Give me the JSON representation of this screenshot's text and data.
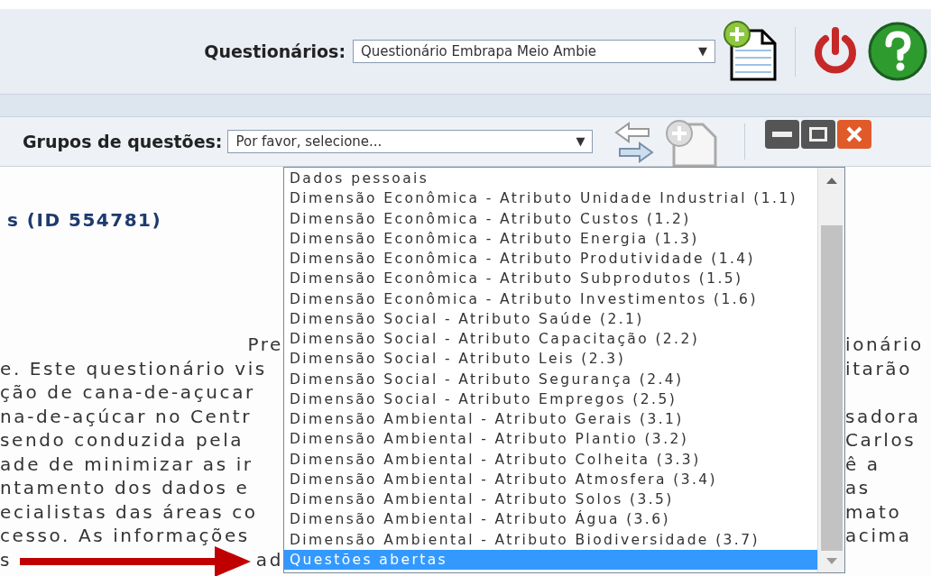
{
  "questionnaire_bar": {
    "label": "Questionários:",
    "value": "Questionário Embrapa Meio Ambie",
    "arrow": "▼"
  },
  "group_bar": {
    "label": "Grupos de questões:",
    "value": "Por favor, selecione...",
    "arrow": "▼"
  },
  "group_options": [
    {
      "label": "Dados pessoais",
      "selected": false
    },
    {
      "label": "Dimensão Econômica - Atributo Unidade Industrial (1.1)",
      "selected": false
    },
    {
      "label": "Dimensão Econômica - Atributo Custos (1.2)",
      "selected": false
    },
    {
      "label": "Dimensão Econômica - Atributo Energia (1.3)",
      "selected": false
    },
    {
      "label": "Dimensão Econômica - Atributo Produtividade (1.4)",
      "selected": false
    },
    {
      "label": "Dimensão Econômica - Atributo Subprodutos (1.5)",
      "selected": false
    },
    {
      "label": "Dimensão Econômica - Atributo Investimentos (1.6)",
      "selected": false
    },
    {
      "label": "Dimensão Social - Atributo Saúde (2.1)",
      "selected": false
    },
    {
      "label": "Dimensão Social - Atributo Capacitação (2.2)",
      "selected": false
    },
    {
      "label": "Dimensão Social - Atributo Leis (2.3)",
      "selected": false
    },
    {
      "label": "Dimensão Social - Atributo Segurança (2.4)",
      "selected": false
    },
    {
      "label": "Dimensão Social - Atributo Empregos (2.5)",
      "selected": false
    },
    {
      "label": "Dimensão Ambiental - Atributo Gerais (3.1)",
      "selected": false
    },
    {
      "label": "Dimensão Ambiental - Atributo Plantio (3.2)",
      "selected": false
    },
    {
      "label": "Dimensão Ambiental - Atributo Colheita (3.3)",
      "selected": false
    },
    {
      "label": "Dimensão Ambiental - Atributo Atmosfera (3.4)",
      "selected": false
    },
    {
      "label": "Dimensão Ambiental - Atributo Solos (3.5)",
      "selected": false
    },
    {
      "label": "Dimensão Ambiental - Atributo Água (3.6)",
      "selected": false
    },
    {
      "label": "Dimensão Ambiental - Atributo Biodiversidade (3.7)",
      "selected": false
    },
    {
      "label": "Questões abertas",
      "selected": true
    }
  ],
  "content": {
    "title": "s (ID 554781)",
    "lines": [
      {
        "left": "Pre",
        "right": "ionário"
      },
      {
        "left": "e. Este questionário vis",
        "right": "itarão"
      },
      {
        "left": "ção de cana-de-açucar"
      },
      {
        "left": "na-de-açúcar no Centr",
        "right": "sadora"
      },
      {
        "left": "sendo conduzida pela",
        "right": "Carlos"
      },
      {
        "left": "ade de minimizar as ir",
        "right": "ê a"
      },
      {
        "left": "ntamento dos dados e",
        "right": "as"
      },
      {
        "left": "ecialistas das áreas co",
        "right": "mato"
      },
      {
        "left": "cesso. As informações",
        "right": "acima"
      },
      {
        "left": "s",
        "left_end": "ad"
      }
    ]
  }
}
